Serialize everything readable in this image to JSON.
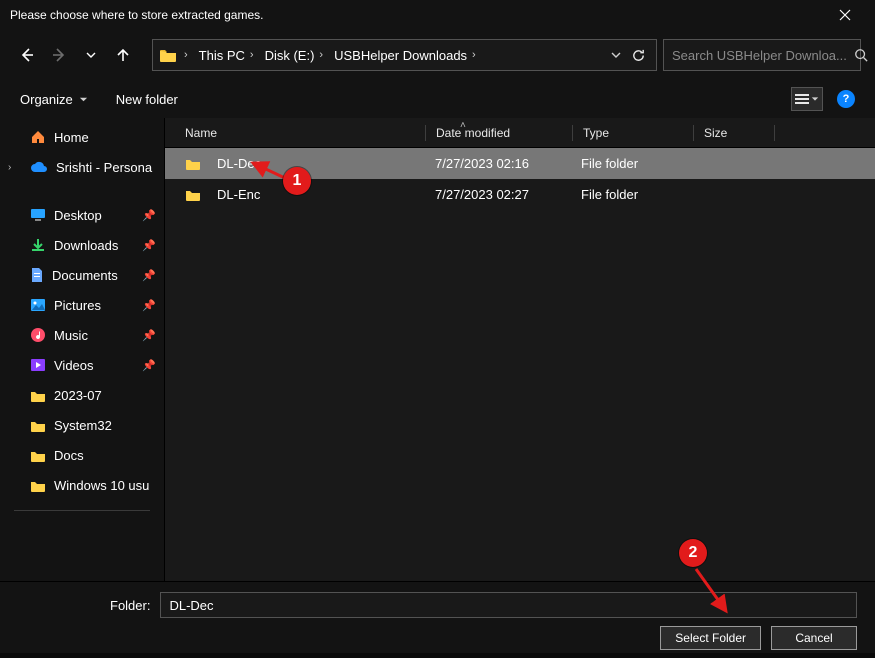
{
  "title": "Please choose where to store extracted games.",
  "breadcrumbs": {
    "root": "This PC",
    "drive": "Disk (E:)",
    "folder": "USBHelper Downloads"
  },
  "search": {
    "placeholder": "Search USBHelper Downloa..."
  },
  "toolbar": {
    "organize": "Organize",
    "newfolder": "New folder"
  },
  "sidebar": {
    "home": "Home",
    "personal": "Srishti - Persona",
    "quick": [
      {
        "label": "Desktop",
        "icon": "desktop"
      },
      {
        "label": "Downloads",
        "icon": "downloads"
      },
      {
        "label": "Documents",
        "icon": "documents"
      },
      {
        "label": "Pictures",
        "icon": "pictures"
      },
      {
        "label": "Music",
        "icon": "music"
      },
      {
        "label": "Videos",
        "icon": "videos"
      },
      {
        "label": "2023-07",
        "icon": "folder"
      },
      {
        "label": "System32",
        "icon": "folder"
      },
      {
        "label": "Docs",
        "icon": "folder"
      },
      {
        "label": "Windows 10 usu",
        "icon": "folder"
      }
    ]
  },
  "columns": {
    "name": "Name",
    "date": "Date modified",
    "type": "Type",
    "size": "Size"
  },
  "files": [
    {
      "name": "DL-Dec",
      "date": "7/27/2023 02:16",
      "type": "File folder",
      "selected": true
    },
    {
      "name": "DL-Enc",
      "date": "7/27/2023 02:27",
      "type": "File folder",
      "selected": false
    }
  ],
  "folderLabel": "Folder:",
  "folderValue": "DL-Dec",
  "buttons": {
    "select": "Select Folder",
    "cancel": "Cancel"
  },
  "annotations": {
    "a1": "1",
    "a2": "2"
  }
}
